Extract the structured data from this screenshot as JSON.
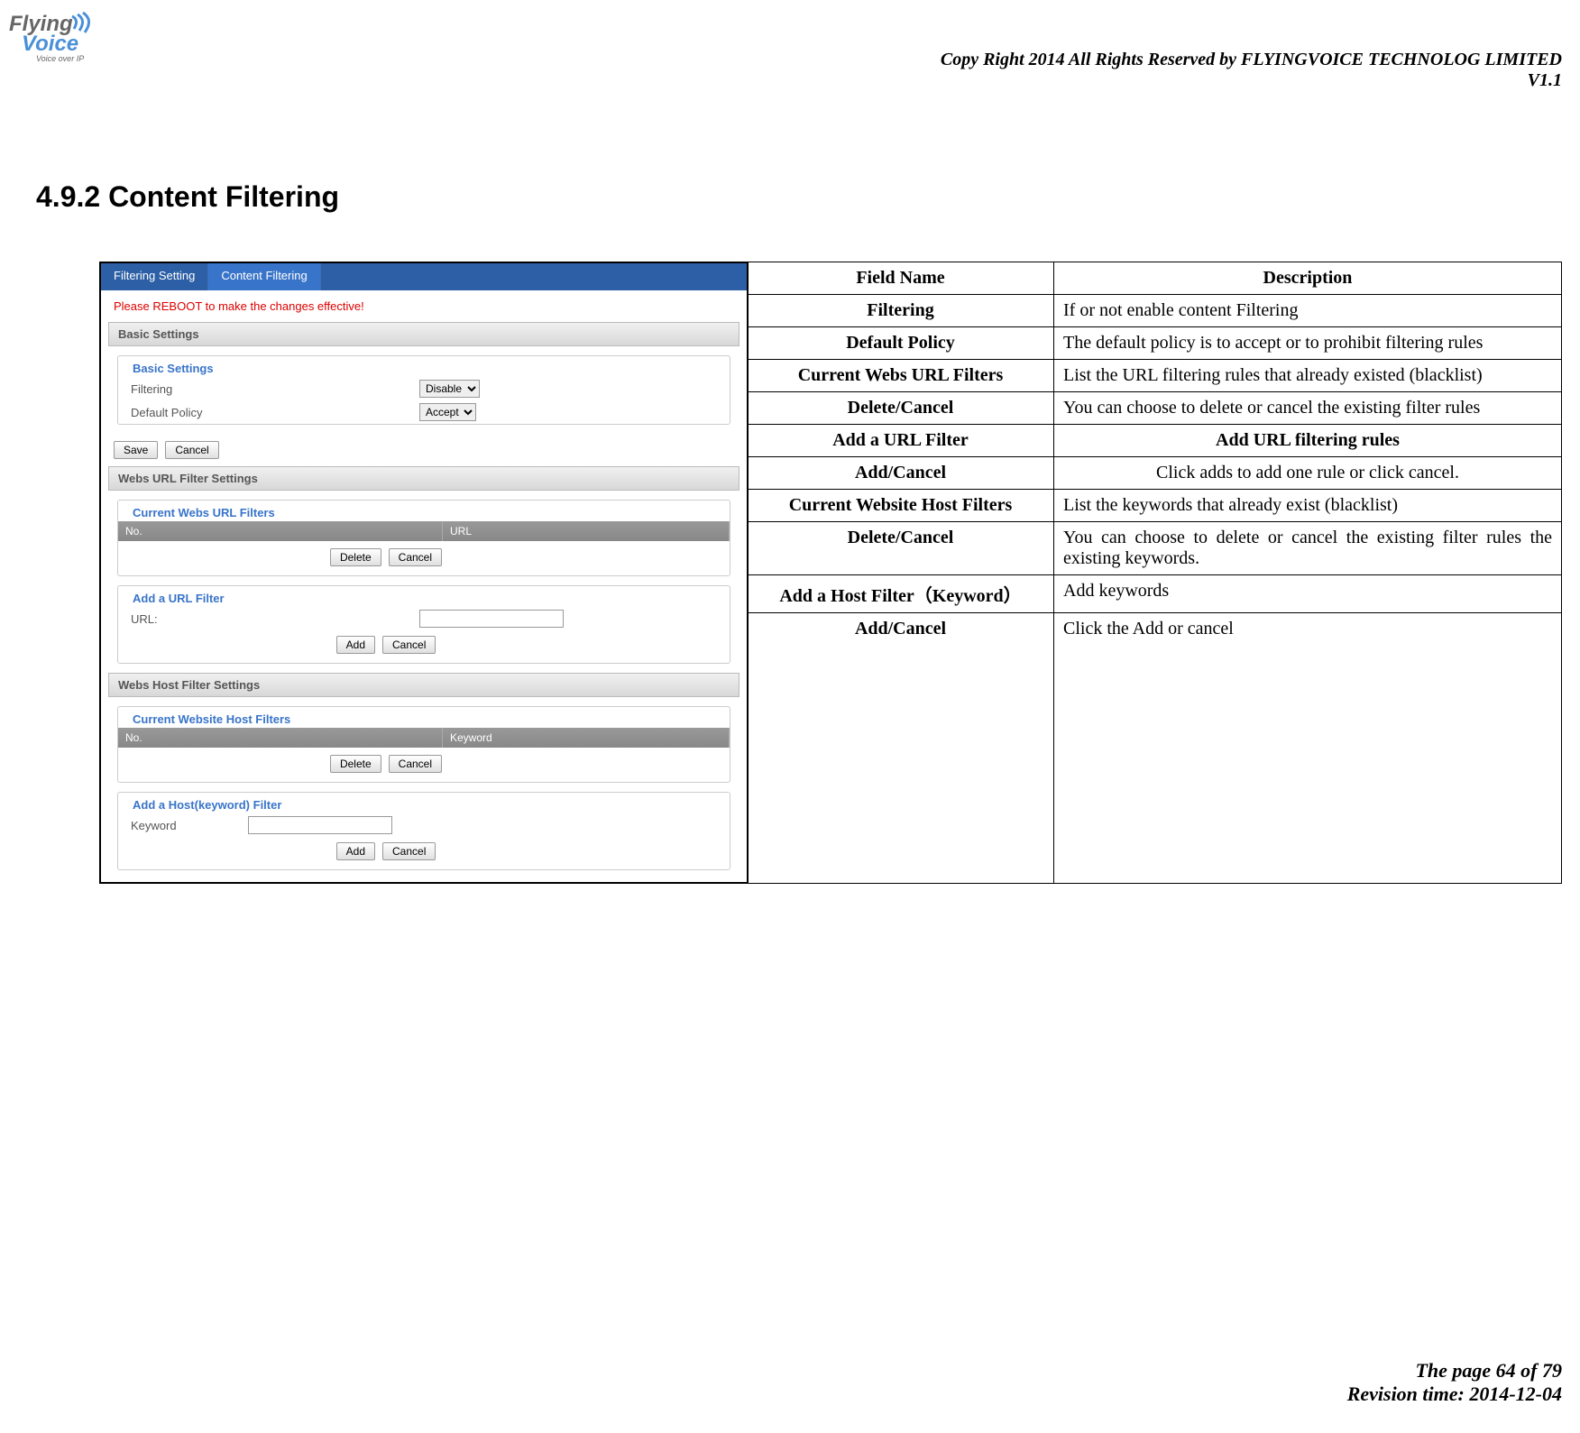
{
  "logo": {
    "part1": "Flying",
    "part2": "Voice",
    "tagline": "Voice over IP"
  },
  "header": {
    "copyright": "Copy Right 2014 All Rights Reserved by FLYINGVOICE TECHNOLOG LIMITED",
    "version": "V1.1"
  },
  "section_title": "4.9.2 Content Filtering",
  "tabs": {
    "t1": "Filtering Setting",
    "t2": "Content Filtering"
  },
  "reboot": "Please REBOOT to make the changes effective!",
  "sections": {
    "basic": "Basic Settings",
    "urlfilter": "Webs URL Filter Settings",
    "hostfilter": "Webs Host Filter Settings"
  },
  "legends": {
    "basic": "Basic Settings",
    "current_url": "Current Webs URL Filters",
    "add_url": "Add a URL Filter",
    "current_host": "Current Website Host Filters",
    "add_host": "Add a Host(keyword) Filter"
  },
  "labels": {
    "filtering": "Filtering",
    "default_policy": "Default Policy",
    "url": "URL:",
    "keyword": "Keyword"
  },
  "selects": {
    "filtering": "Disable",
    "policy": "Accept"
  },
  "buttons": {
    "save": "Save",
    "cancel": "Cancel",
    "delete": "Delete",
    "add": "Add"
  },
  "cols": {
    "no": "No.",
    "url": "URL",
    "keyword": "Keyword"
  },
  "desc_table": {
    "h1": "Field Name",
    "h2": "Description",
    "r1": {
      "f": "Filtering",
      "d": "If or not enable content Filtering"
    },
    "r2": {
      "f": "Default Policy",
      "d": "The default policy is to accept or to prohibit filtering rules"
    },
    "r3": {
      "f": "Current Webs URL Filters",
      "d": "List the URL filtering rules that already existed (blacklist)"
    },
    "r4": {
      "f": "Delete/Cancel",
      "d": "You can choose to delete or cancel the existing filter rules"
    },
    "r5": {
      "f": "Add a URL Filter",
      "d": "Add URL filtering rules"
    },
    "r6": {
      "f": "Add/Cancel",
      "d": "Click adds to add one rule or click cancel."
    },
    "r7": {
      "f": "Current Website Host Filters",
      "d": "List the keywords that already exist (blacklist)"
    },
    "r8": {
      "f": "Delete/Cancel",
      "d": "You can choose to delete or cancel the existing filter rules the existing keywords."
    },
    "r9": {
      "f": "Add a Host Filter（Keyword）",
      "d": "Add keywords"
    },
    "r10": {
      "f": "Add/Cancel",
      "d": "Click the Add or cancel"
    }
  },
  "footer": {
    "page": "The page 64 of 79",
    "revision": "Revision time: 2014-12-04"
  }
}
